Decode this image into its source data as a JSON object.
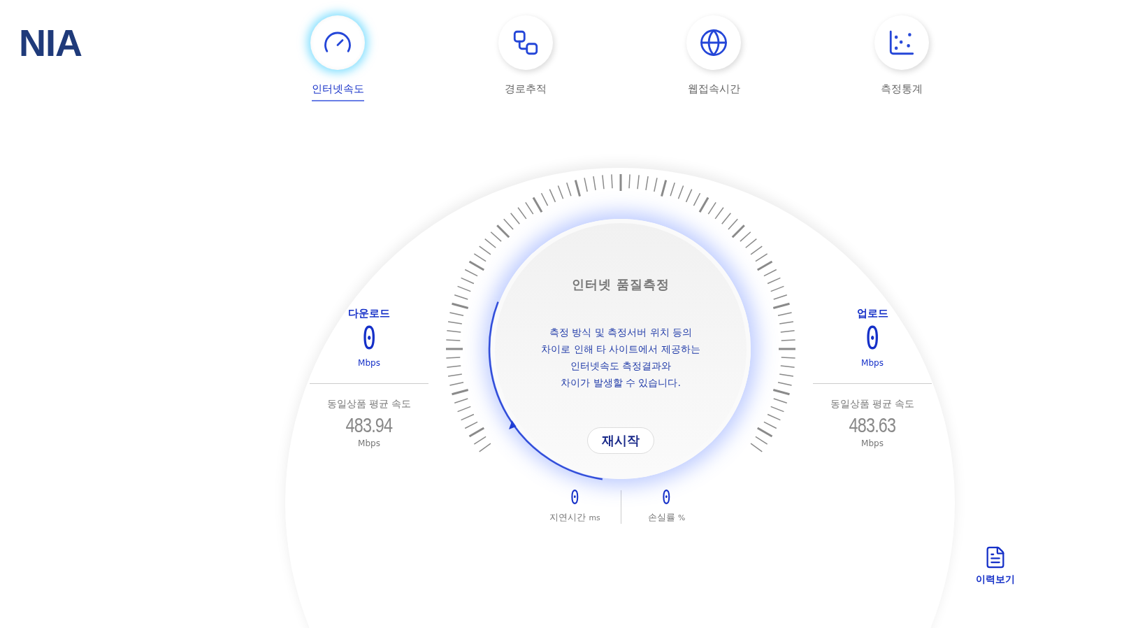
{
  "logo": "NIA",
  "tabs": [
    {
      "label": "인터넷속도",
      "selected": true
    },
    {
      "label": "경로추적",
      "selected": false
    },
    {
      "label": "웹접속시간",
      "selected": false
    },
    {
      "label": "측정통계",
      "selected": false
    }
  ],
  "download": {
    "title": "다운로드",
    "value": "0",
    "unit": "Mbps",
    "avg_label": "동일상품 평균 속도",
    "avg_value": "483.94",
    "avg_unit": "Mbps"
  },
  "upload": {
    "title": "업로드",
    "value": "0",
    "unit": "Mbps",
    "avg_label": "동일상품 평균 속도",
    "avg_value": "483.63",
    "avg_unit": "Mbps"
  },
  "gauge": {
    "title": "인터넷 품질측정",
    "notice": [
      "측정 방식 및 측정서버 위치 등의",
      "차이로 인해 타 사이트에서 제공하는",
      "인터넷속도 측정결과와",
      "차이가 발생할 수 있습니다."
    ],
    "restart": "재시작"
  },
  "stats": [
    {
      "value": "0",
      "label": "지연시간",
      "unit": "ms"
    },
    {
      "value": "0",
      "label": "손실률",
      "unit": "%"
    }
  ],
  "history": {
    "label": "이력보기"
  }
}
